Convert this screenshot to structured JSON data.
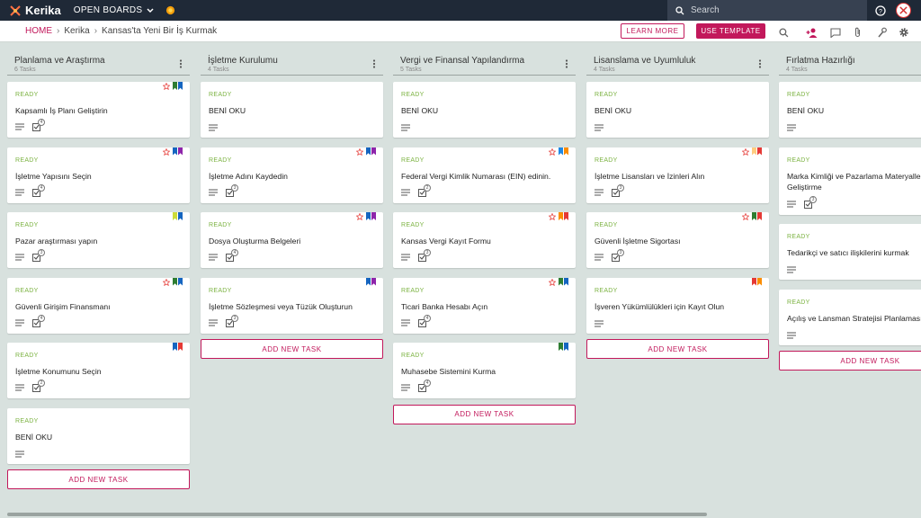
{
  "topbar": {
    "logo": "Kerika",
    "open_boards": "OPEN BOARDS",
    "search_placeholder": "Search"
  },
  "breadcrumb": {
    "home": "HOME",
    "account": "Kerika",
    "board": "Kansas'ta Yeni Bir İş Kurmak"
  },
  "actions": {
    "learn_more": "LEARN MORE",
    "use_template": "USE TEMPLATE"
  },
  "colors": {
    "accent": "#c2185b",
    "ready": "#7cb342"
  },
  "columns": [
    {
      "title": "Planlama ve Araştırma",
      "count": "6 Tasks",
      "add_label": "ADD NEW TASK",
      "cards": [
        {
          "status": "READY",
          "title": "Kapsamlı İş Planı Geliştirin",
          "star": true,
          "flags": [
            "#2e7d32",
            "#1565c0"
          ],
          "checklist": "4"
        },
        {
          "status": "READY",
          "title": "İşletme Yapısını Seçin",
          "star": true,
          "flags": [
            "#1565c0",
            "#8e24aa"
          ],
          "checklist": "4"
        },
        {
          "status": "READY",
          "title": "Pazar araştırması yapın",
          "star": false,
          "flags": [
            "#cddc39",
            "#1565c0"
          ],
          "checklist": "3"
        },
        {
          "status": "READY",
          "title": "Güvenli Girişim Finansmanı",
          "star": true,
          "flags": [
            "#2e7d32",
            "#1565c0"
          ],
          "checklist": "4"
        },
        {
          "status": "READY",
          "title": "İşletme Konumunu Seçin",
          "star": false,
          "flags": [
            "#1565c0",
            "#e53935"
          ],
          "checklist": "2"
        },
        {
          "status": "READY",
          "title": "BENİ OKU",
          "star": false,
          "flags": [],
          "checklist": null
        }
      ]
    },
    {
      "title": "İşletme Kurulumu",
      "count": "4 Tasks",
      "add_label": "ADD NEW TASK",
      "cards": [
        {
          "status": "READY",
          "title": "BENİ OKU",
          "star": false,
          "flags": [],
          "checklist": null
        },
        {
          "status": "READY",
          "title": "İşletme Adını Kaydedin",
          "star": true,
          "flags": [
            "#1565c0",
            "#8e24aa"
          ],
          "checklist": "3"
        },
        {
          "status": "READY",
          "title": "Dosya Oluşturma Belgeleri",
          "star": true,
          "flags": [
            "#1565c0",
            "#8e24aa"
          ],
          "checklist": "4"
        },
        {
          "status": "READY",
          "title": "İşletme Sözleşmesi veya Tüzük Oluşturun",
          "star": false,
          "flags": [
            "#1565c0",
            "#8e24aa"
          ],
          "checklist": "3"
        }
      ]
    },
    {
      "title": "Vergi ve Finansal Yapılandırma",
      "count": "5 Tasks",
      "add_label": "ADD NEW TASK",
      "cards": [
        {
          "status": "READY",
          "title": "BENİ OKU",
          "star": false,
          "flags": [],
          "checklist": null
        },
        {
          "status": "READY",
          "title": "Federal Vergi Kimlik Numarası (EIN) edinin.",
          "star": true,
          "flags": [
            "#1e88e5",
            "#fb8c00"
          ],
          "checklist": "2"
        },
        {
          "status": "READY",
          "title": "Kansas Vergi Kayıt Formu",
          "star": true,
          "flags": [
            "#fb8c00",
            "#e53935"
          ],
          "checklist": "3"
        },
        {
          "status": "READY",
          "title": "Ticari Banka Hesabı Açın",
          "star": true,
          "flags": [
            "#2e7d32",
            "#1565c0"
          ],
          "checklist": "4"
        },
        {
          "status": "READY",
          "title": "Muhasebe Sistemini Kurma",
          "star": false,
          "flags": [
            "#2e7d32",
            "#1565c0"
          ],
          "checklist": "4"
        }
      ]
    },
    {
      "title": "Lisanslama ve Uyumluluk",
      "count": "4 Tasks",
      "add_label": "ADD NEW TASK",
      "cards": [
        {
          "status": "READY",
          "title": "BENİ OKU",
          "star": false,
          "flags": [],
          "checklist": null
        },
        {
          "status": "READY",
          "title": "İşletme Lisansları ve İzinleri Alın",
          "star": true,
          "flags": [
            "#ffcc80",
            "#e53935"
          ],
          "checklist": "3"
        },
        {
          "status": "READY",
          "title": "Güvenli İşletme Sigortası",
          "star": true,
          "flags": [
            "#2e7d32",
            "#e53935"
          ],
          "checklist": "3"
        },
        {
          "status": "READY",
          "title": "İşveren Yükümlülükleri için Kayıt Olun",
          "star": false,
          "flags": [
            "#e53935",
            "#fb8c00"
          ],
          "checklist": null
        }
      ]
    },
    {
      "title": "Fırlatma Hazırlığı",
      "count": "4 Tasks",
      "add_label": "ADD NEW TASK",
      "cards": [
        {
          "status": "READY",
          "title": "BENİ OKU",
          "star": false,
          "flags": [],
          "checklist": null
        },
        {
          "status": "READY",
          "title": "Marka Kimliği ve Pazarlama Materyalleri Geliştirme",
          "star": false,
          "flags": [],
          "checklist": "3"
        },
        {
          "status": "READY",
          "title": "Tedarikçi ve satıcı ilişkilerini kurmak",
          "star": false,
          "flags": [],
          "checklist": null
        },
        {
          "status": "READY",
          "title": "Açılış ve Lansman Stratejisi Planlaması",
          "star": false,
          "flags": [],
          "checklist": null
        }
      ]
    }
  ]
}
